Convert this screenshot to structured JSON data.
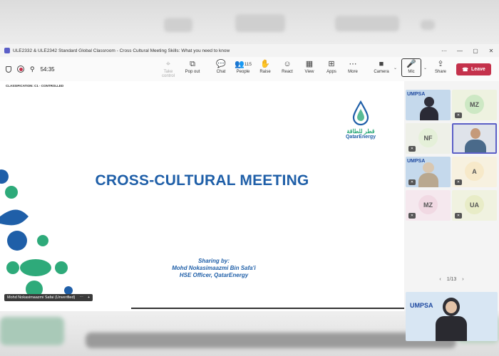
{
  "window": {
    "title": "ULE2332 & ULE2342 Standard Global Classroom - Cross Cultural Meeting Skills: What you need to know"
  },
  "toolbar": {
    "timer": "54:35",
    "tools": [
      {
        "label": "Take control",
        "icon": "take-control-icon",
        "glyph": "⌖",
        "disabled": true
      },
      {
        "label": "Pop out",
        "icon": "pop-out-icon",
        "glyph": "⧉",
        "disabled": false
      },
      {
        "label": "Chat",
        "icon": "chat-icon",
        "glyph": "💬",
        "disabled": false
      },
      {
        "label": "People",
        "icon": "people-icon",
        "glyph": "👥",
        "disabled": false,
        "count": "115"
      },
      {
        "label": "Raise",
        "icon": "raise-hand-icon",
        "glyph": "✋",
        "disabled": false
      },
      {
        "label": "React",
        "icon": "react-icon",
        "glyph": "☺",
        "disabled": false
      },
      {
        "label": "View",
        "icon": "view-icon",
        "glyph": "▦",
        "disabled": false
      },
      {
        "label": "Apps",
        "icon": "apps-icon",
        "glyph": "⊞",
        "disabled": false
      },
      {
        "label": "More",
        "icon": "more-icon",
        "glyph": "⋯",
        "disabled": false
      },
      {
        "label": "Camera",
        "icon": "camera-icon",
        "glyph": "■",
        "disabled": false
      },
      {
        "label": "Mic",
        "icon": "mic-icon",
        "glyph": "🎤",
        "disabled": false
      },
      {
        "label": "Share",
        "icon": "share-icon",
        "glyph": "⇪",
        "disabled": false
      }
    ],
    "leave_label": "Leave",
    "accent": "#c4314b"
  },
  "slide": {
    "classification": "CLASSIFICATION: C1 - CONTROLLED",
    "title": "CROSS-CULTURAL MEETING",
    "sharing_label": "Sharing by:",
    "presenter_name": "Mohd Nokasimaazmi Bin Safa'i",
    "presenter_role": "HSE Officer, QatarEnergy",
    "logo_arabic": "قطر للطاقة",
    "logo_name": "QatarEnergy",
    "title_color": "#1f5fa8"
  },
  "presenter_tag": {
    "name": "Mohd Nokasimaazmi Safai (Unverified)"
  },
  "participants": {
    "tiles": [
      {
        "type": "video",
        "logo": "UMPSA",
        "initials": ""
      },
      {
        "type": "initials",
        "logo": "",
        "initials": "MZ",
        "color": "#cde8c4"
      },
      {
        "type": "initials",
        "logo": "",
        "initials": "NF",
        "color": "#e5f0d9"
      },
      {
        "type": "video",
        "logo": "",
        "initials": ""
      },
      {
        "type": "video",
        "logo": "UMPSA",
        "initials": ""
      },
      {
        "type": "initials",
        "logo": "",
        "initials": "A",
        "color": "#f7e9c9"
      },
      {
        "type": "initials",
        "logo": "",
        "initials": "MZ",
        "color": "#f1d9e3"
      },
      {
        "type": "initials",
        "logo": "",
        "initials": "UA",
        "color": "#e8ecc7"
      }
    ],
    "pager": "1/13",
    "featured_logo": "UMPSA"
  }
}
